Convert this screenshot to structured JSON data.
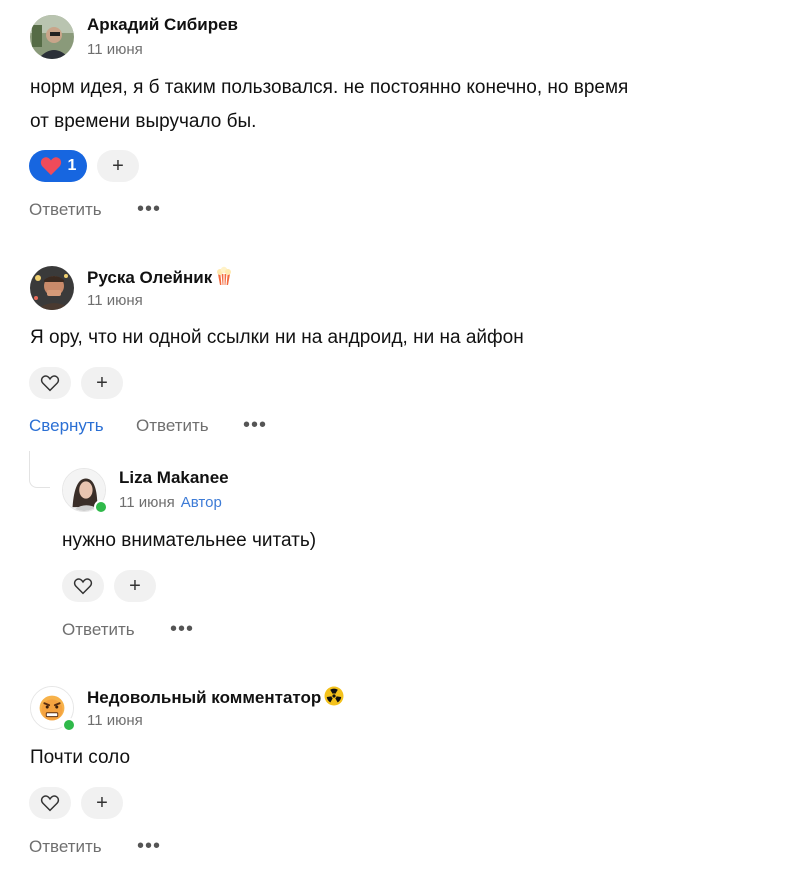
{
  "colors": {
    "accent": "#1766e0",
    "link": "#2a6fd4",
    "online": "#2fb94a",
    "muted": "#6f6f6f"
  },
  "comments": [
    {
      "author": "Аркадий Сибирев",
      "date": "11 июня",
      "text_line1": "норм идея, я б таким пользовался. не постоянно конечно, но время",
      "text_line2": "от времени выручало бы.",
      "reaction_icon": "heart-icon",
      "reaction_count": "1",
      "reply_label": "Ответить",
      "more_label": "•••"
    },
    {
      "author": "Руска Олейник",
      "author_emoji": "popcorn-icon",
      "date": "11 июня",
      "text_line1": "Я ору, что ни одной ссылки ни на андроид, ни на айфон",
      "collapse_label": "Свернуть",
      "reply_label": "Ответить",
      "more_label": "•••"
    },
    {
      "author": "Liza Makanee",
      "date": "11 июня",
      "badge": "Автор",
      "text_line1": "нужно внимательнее читать)",
      "reply_label": "Ответить",
      "more_label": "•••"
    },
    {
      "author": "Недовольный комментатор",
      "author_emoji": "radioactive-icon",
      "date": "11 июня",
      "text_line1": "Почти соло",
      "reply_label": "Ответить",
      "more_label": "•••"
    }
  ],
  "add_reaction_symbol": "+"
}
